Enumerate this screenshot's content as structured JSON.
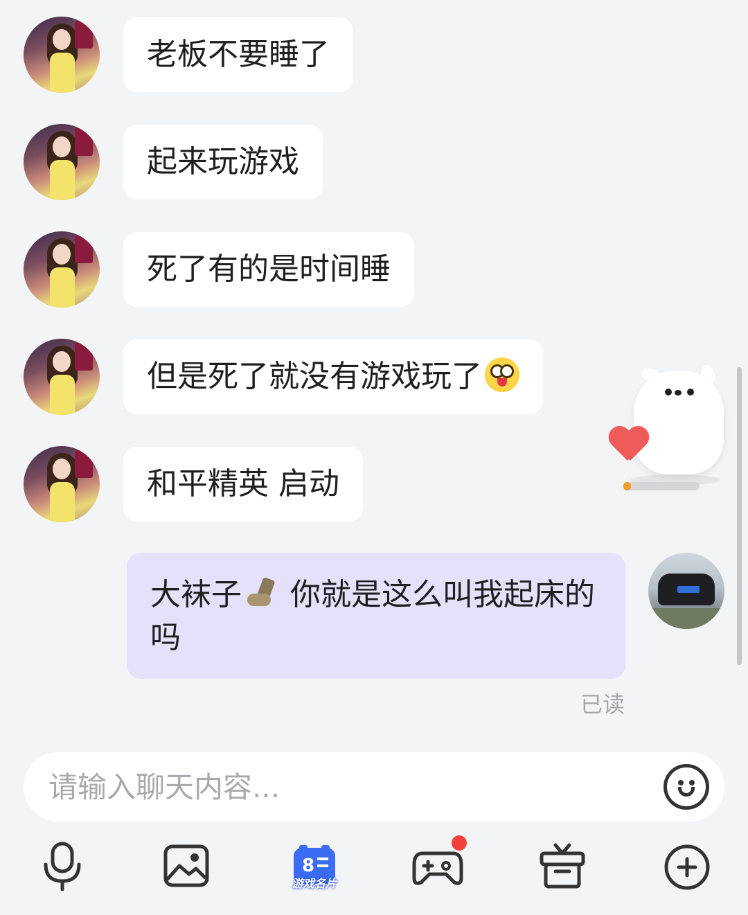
{
  "messages_in": [
    {
      "text": "老板不要睡了"
    },
    {
      "text": "起来玩游戏"
    },
    {
      "text": "死了有的是时间睡"
    },
    {
      "text": "但是死了就没有游戏玩了"
    },
    {
      "text": "和平精英 启动"
    }
  ],
  "message_out": {
    "part1": "大袜子",
    "part2": " 你就是这么叫我起床的",
    "part3": "吗"
  },
  "read_status": "已读",
  "input": {
    "placeholder": "请输入聊天内容..."
  },
  "toolbar": {
    "game_card_label": "游戏名片"
  },
  "widget": {
    "progress": 0.08
  },
  "colors": {
    "background": "#f3f4f6",
    "incoming_bubble": "#ffffff",
    "outgoing_bubble": "#e6e1fb",
    "accent_blue": "#3a6cf4",
    "badge_red": "#f2413a",
    "progress_orange": "#f39a2a"
  }
}
